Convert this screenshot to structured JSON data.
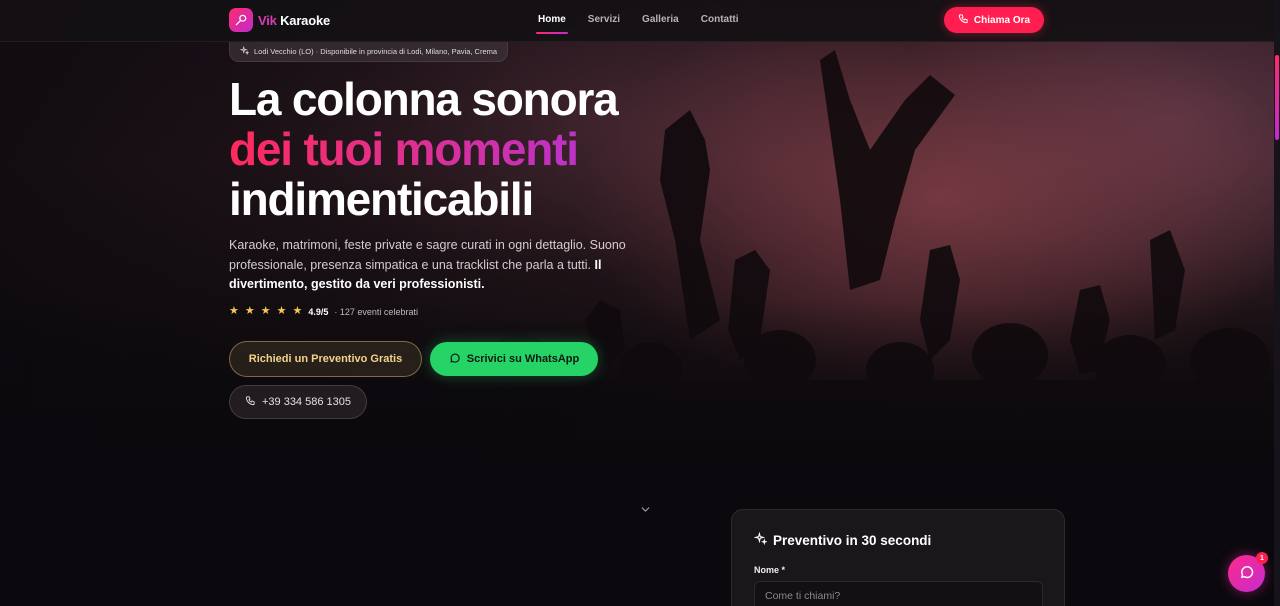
{
  "brand": {
    "prefix": "Vik",
    "name": "Karaoke"
  },
  "nav": {
    "links": [
      {
        "label": "Home",
        "active": true
      },
      {
        "label": "Servizi",
        "active": false
      },
      {
        "label": "Galleria",
        "active": false
      },
      {
        "label": "Contatti",
        "active": false
      }
    ],
    "call_label": "Chiama Ora"
  },
  "hero": {
    "location_pill": "Lodi Vecchio (LO) · Disponibile in provincia di Lodi, Milano, Pavia, Crema",
    "headline_line1": "La colonna sonora",
    "headline_line2": "dei tuoi momenti",
    "headline_line3": "indimenticabili",
    "subtitle": "Karaoke, matrimoni, feste private e sagre curati in ogni dettaglio. Suono professionale, presenza simpatica e una tracklist che parla a tutti.",
    "subtitle_strong": "Il divertimento, gestito da veri professionisti.",
    "rating_stars": 5,
    "rating_score": "4.9/5",
    "rating_detail": "· 127 eventi celebrati",
    "cta_quote": "Richiedi un Preventivo Gratis",
    "cta_whatsapp": "Scrivici su WhatsApp",
    "phone": "+39 334 586 1305"
  },
  "quote_card": {
    "title": "Preventivo in 30 secondi",
    "name_label": "Nome *",
    "name_placeholder": "Come ti chiami?"
  },
  "chat": {
    "badge_count": "1"
  },
  "colors": {
    "accent_red": "#ff1e4f",
    "accent_magenta": "#c02bd0",
    "whatsapp_green": "#25d366",
    "star_gold": "#f3c94d"
  },
  "icons": [
    "microphone-icon",
    "phone-icon",
    "sparkles-icon",
    "star-icon",
    "whatsapp-icon",
    "chevron-down-icon",
    "chat-bubble-icon"
  ]
}
